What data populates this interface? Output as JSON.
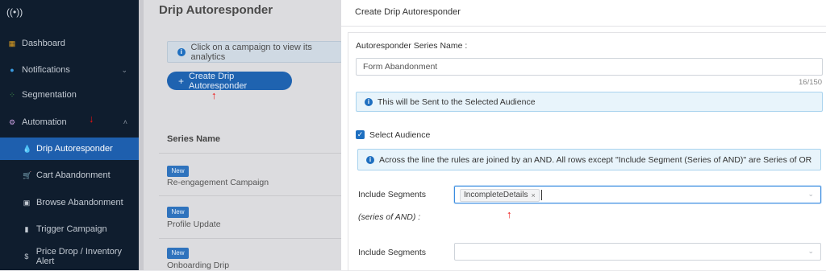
{
  "sidebar": {
    "items": [
      {
        "label": "Dashboard",
        "icon": "dashboard-icon"
      },
      {
        "label": "Notifications",
        "icon": "bell-icon"
      },
      {
        "label": "Segmentation",
        "icon": "segmentation-icon"
      },
      {
        "label": "Automation",
        "icon": "automation-icon"
      },
      {
        "label": "Drip Autoresponder",
        "icon": "drip-icon"
      },
      {
        "label": "Cart Abandonment",
        "icon": "cart-icon"
      },
      {
        "label": "Browse Abandonment",
        "icon": "browse-icon"
      },
      {
        "label": "Trigger Campaign",
        "icon": "trigger-icon"
      },
      {
        "label": "Price Drop / Inventory Alert",
        "icon": "price-tag-icon"
      }
    ]
  },
  "page": {
    "title": "Drip Autoresponder",
    "info_text": "Click on a campaign to view its analytics",
    "create_button": "Create Drip Autoresponder",
    "column_header": "Series Name",
    "rows": [
      {
        "badge": "New",
        "name": "Re-engagement Campaign"
      },
      {
        "badge": "New",
        "name": "Profile Update"
      },
      {
        "badge": "New",
        "name": "Onboarding Drip"
      }
    ]
  },
  "panel": {
    "title": "Create Drip Autoresponder",
    "series_name_label": "Autoresponder Series Name :",
    "series_name_value": "Form Abandonment",
    "char_counter": "16/150",
    "audience_alert": "This will be Sent to the Selected Audience",
    "select_audience_label": "Select Audience",
    "rules_alert": "Across the line the rules are joined by an AND. All rows except \"Include Segment (Series of AND)\" are Series of OR",
    "include_segments_label": "Include Segments",
    "series_of_and_label": "(series of AND) :",
    "selected_tag": "IncompleteDetails",
    "include_segments_label_2": "Include Segments"
  },
  "colors": {
    "sidebar_bg": "#0f1d2e",
    "active_nav": "#1e5fae",
    "primary": "#1e6fc0",
    "annotation_arrow": "#ee1111"
  }
}
